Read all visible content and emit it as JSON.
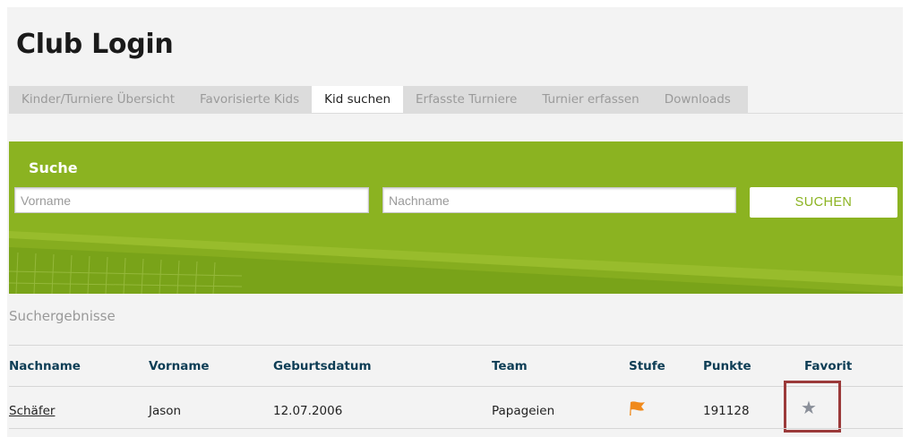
{
  "page_title": "Club Login",
  "tabs": [
    {
      "label": "Kinder/Turniere Übersicht",
      "active": false
    },
    {
      "label": "Favorisierte Kids",
      "active": false
    },
    {
      "label": "Kid suchen",
      "active": true
    },
    {
      "label": "Erfasste Turniere",
      "active": false
    },
    {
      "label": "Turnier erfassen",
      "active": false
    },
    {
      "label": "Downloads",
      "active": false
    }
  ],
  "search": {
    "title": "Suche",
    "firstname_placeholder": "Vorname",
    "lastname_placeholder": "Nachname",
    "button_label": "SUCHEN"
  },
  "results": {
    "title": "Suchergebnisse",
    "columns": [
      "Nachname",
      "Vorname",
      "Geburtsdatum",
      "Team",
      "Stufe",
      "Punkte",
      "Favorit"
    ],
    "rows": [
      {
        "nachname": "Schäfer",
        "vorname": "Jason",
        "geburtsdatum": "12.07.2006",
        "team": "Papageien",
        "stufe_icon": "flag-icon",
        "punkte": "191128",
        "favorit_icon": "star-icon"
      }
    ]
  },
  "colors": {
    "search_panel": "#8bb321",
    "header_text": "#0d3d55",
    "flag": "#f08a1c",
    "highlight_box": "#9b3a3a",
    "star": "#8a8f99"
  }
}
